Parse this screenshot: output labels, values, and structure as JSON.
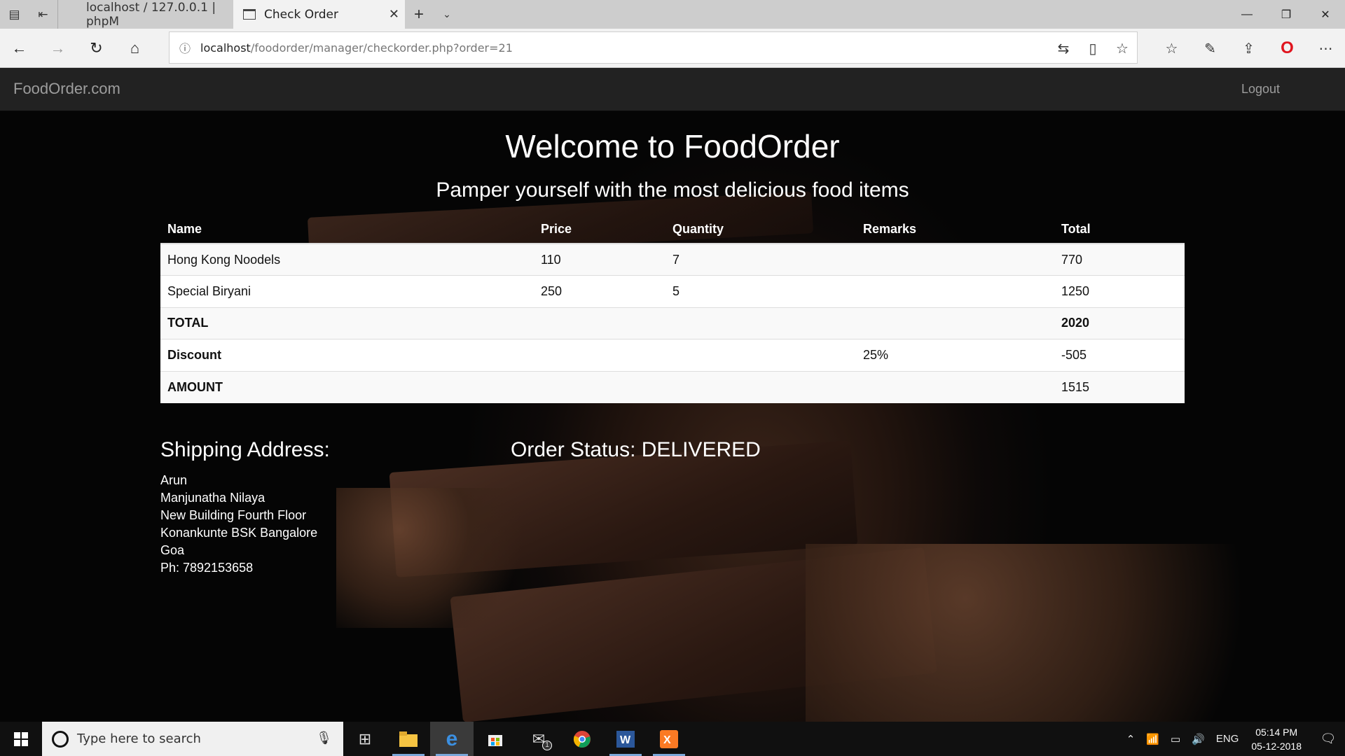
{
  "browser": {
    "tabs": [
      {
        "title": "localhost / 127.0.0.1 | phpM",
        "active": false
      },
      {
        "title": "Check Order",
        "active": true
      }
    ],
    "url_host": "localhost",
    "url_path": "/foodorder/manager/checkorder.php?order=21"
  },
  "navbar": {
    "brand": "FoodOrder.com",
    "logout": "Logout"
  },
  "hero": {
    "title": "Welcome to FoodOrder",
    "tagline": "Pamper yourself with the most delicious food items"
  },
  "order_table": {
    "headers": [
      "Name",
      "Price",
      "Quantity",
      "Remarks",
      "Total"
    ],
    "items": [
      {
        "name": "Hong Kong Noodels",
        "price": "110",
        "quantity": "7",
        "remarks": "",
        "total": "770"
      },
      {
        "name": "Special Biryani",
        "price": "250",
        "quantity": "5",
        "remarks": "",
        "total": "1250"
      }
    ],
    "summary": {
      "total_label": "TOTAL",
      "total_value": "2020",
      "discount_label": "Discount",
      "discount_pct": "25%",
      "discount_value": "-505",
      "amount_label": "AMOUNT",
      "amount_value": "1515"
    }
  },
  "shipping": {
    "heading": "Shipping Address:",
    "lines": [
      "Arun",
      "Manjunatha Nilaya",
      "New Building Fourth Floor",
      "Konankunte BSK Bangalore",
      "Goa",
      "Ph: 7892153658"
    ]
  },
  "order_status": "Order Status: DELIVERED",
  "taskbar": {
    "search_placeholder": "Type here to search",
    "language": "ENG",
    "time": "05:14 PM",
    "date": "05-12-2018",
    "mail_badge": "1"
  }
}
